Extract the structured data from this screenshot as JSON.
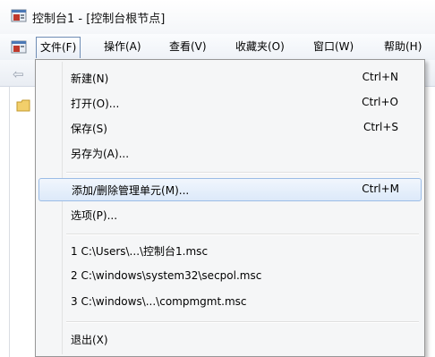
{
  "window": {
    "title": "控制台1 - [控制台根节点]"
  },
  "menubar": {
    "items": [
      {
        "label": "文件(F)",
        "active": true
      },
      {
        "label": "操作(A)"
      },
      {
        "label": "查看(V)"
      },
      {
        "label": "收藏夹(O)"
      },
      {
        "label": "窗口(W)"
      },
      {
        "label": "帮助(H)"
      }
    ]
  },
  "file_menu": {
    "items": [
      {
        "label": "新建(N)",
        "shortcut": "Ctrl+N"
      },
      {
        "label": "打开(O)...",
        "shortcut": "Ctrl+O"
      },
      {
        "label": "保存(S)",
        "shortcut": "Ctrl+S"
      },
      {
        "label": "另存为(A)..."
      },
      {
        "label": "添加/删除管理单元(M)...",
        "shortcut": "Ctrl+M",
        "highlighted": true
      },
      {
        "label": "选项(P)..."
      },
      {
        "label": "1 C:\\Users\\...\\控制台1.msc"
      },
      {
        "label": "2 C:\\windows\\system32\\secpol.msc"
      },
      {
        "label": "3 C:\\windows\\...\\compmgmt.msc"
      },
      {
        "label": "退出(X)"
      }
    ]
  },
  "icons": {
    "app": "mmc-console-icon",
    "back": "back-arrow-icon",
    "folder": "folder-icon"
  },
  "colors": {
    "highlight_border": "#9bbce6",
    "menu_background": "#f5f6f7",
    "accent_red": "#c0392b"
  }
}
